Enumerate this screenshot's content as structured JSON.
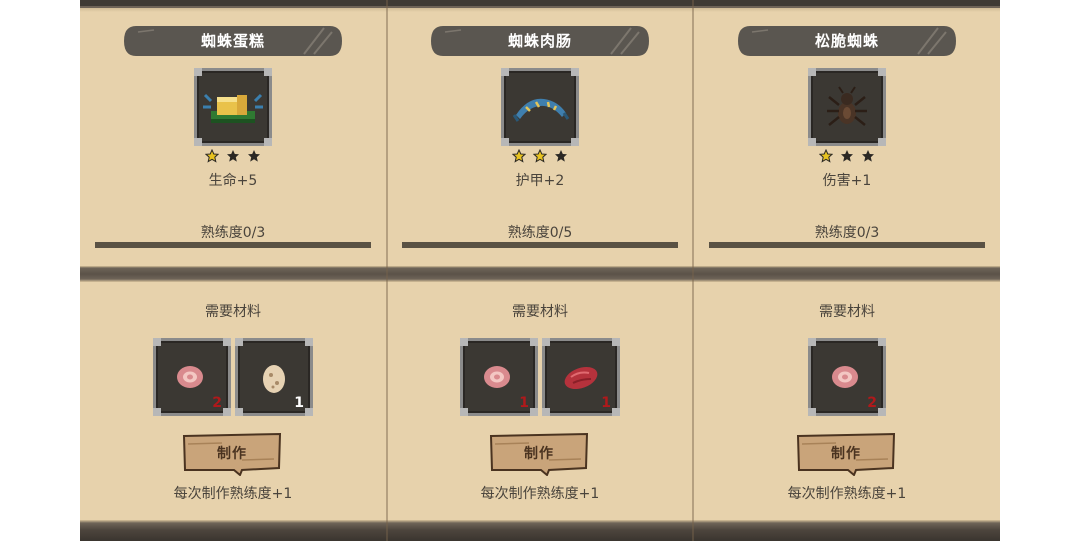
{
  "recipes": [
    {
      "name": "蜘蛛蛋糕",
      "icon": "spider-cake-icon",
      "stars_filled": 1,
      "stars_total": 3,
      "stat": "生命+5",
      "proficiency": "熟练度0/3",
      "materials_label": "需要材料",
      "materials": [
        {
          "icon": "raw-meat-icon",
          "qty": "2"
        },
        {
          "icon": "spider-egg-icon",
          "qty": "1"
        }
      ],
      "craft_label": "制作",
      "note": "每次制作熟练度+1"
    },
    {
      "name": "蜘蛛肉肠",
      "icon": "spider-sausage-icon",
      "stars_filled": 2,
      "stars_total": 3,
      "stat": "护甲+2",
      "proficiency": "熟练度0/5",
      "materials_label": "需要材料",
      "materials": [
        {
          "icon": "raw-meat-icon",
          "qty": "1"
        },
        {
          "icon": "red-meat-icon",
          "qty": "1"
        }
      ],
      "craft_label": "制作",
      "note": "每次制作熟练度+1"
    },
    {
      "name": "松脆蜘蛛",
      "icon": "crispy-spider-icon",
      "stars_filled": 1,
      "stars_total": 3,
      "stat": "伤害+1",
      "proficiency": "熟练度0/3",
      "materials_label": "需要材料",
      "materials": [
        {
          "icon": "raw-meat-icon",
          "qty": "2"
        }
      ],
      "craft_label": "制作",
      "note": "每次制作熟练度+1"
    }
  ],
  "colors": {
    "parchment": "#e7d2ac",
    "banner": "#5a5650",
    "star_filled": "#e8c320",
    "star_empty": "#2b2824",
    "qty_red": "#b0191b",
    "button_wood": "#c9a47a"
  }
}
